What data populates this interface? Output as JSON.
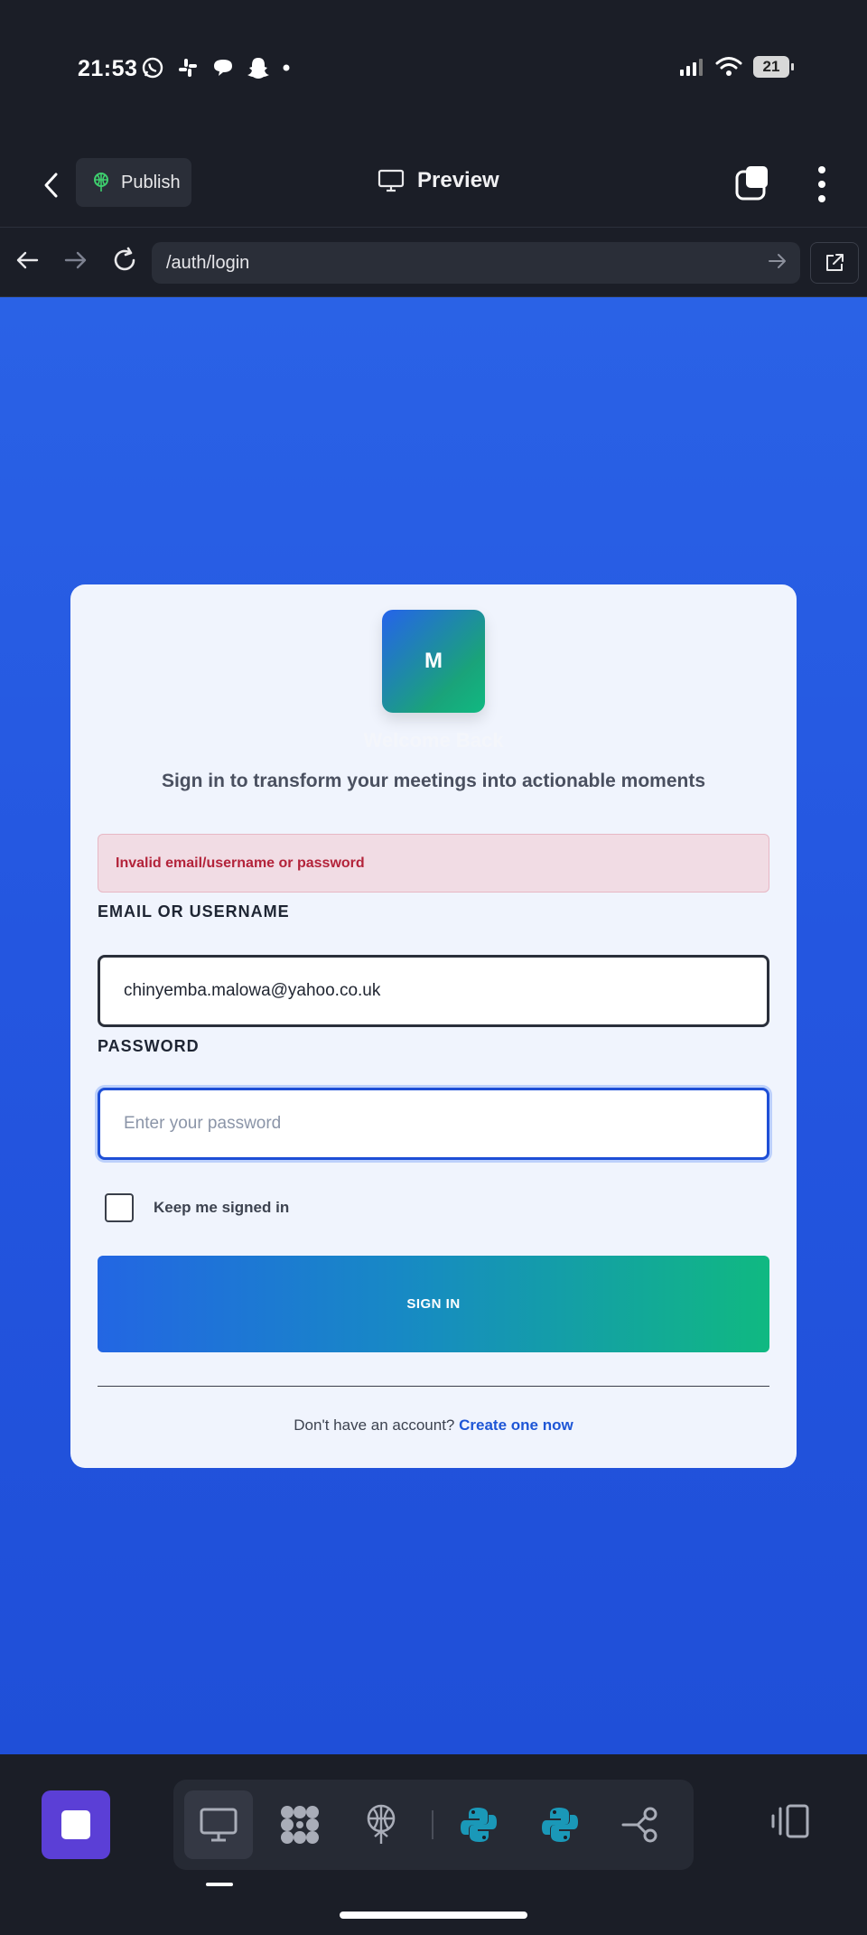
{
  "status_bar": {
    "time": "21:53",
    "battery": "21",
    "notification_icons": [
      "whatsapp-icon",
      "slack-icon",
      "chat-bubble-icon",
      "snapchat-icon",
      "dot-icon"
    ]
  },
  "app_header": {
    "publish_label": "Publish",
    "preview_label": "Preview"
  },
  "url_bar": {
    "url": "/auth/login"
  },
  "login_card": {
    "logo_letter": "M",
    "welcome": "Welcome Back",
    "subtitle": "Sign in to transform your meetings into actionable moments",
    "error": "Invalid email/username or password",
    "email_label": "EMAIL OR USERNAME",
    "email_value": "chinyemba.malowa@yahoo.co.uk",
    "password_label": "PASSWORD",
    "password_placeholder": "Enter your password",
    "remember_label": "Keep me signed in",
    "remember_checked": false,
    "signin_label": "SIGN IN",
    "signup_prompt": "Don't have an account?",
    "signup_link": "Create one now"
  },
  "colors": {
    "accent_blue": "#2366e3",
    "accent_green": "#10b981",
    "error_red": "#b3233a",
    "background_blue": "#2456e0",
    "dark_chrome": "#1b1e27"
  },
  "dock": {
    "tools": [
      "desktop-icon",
      "apps-grid-icon",
      "publish-tree-icon",
      "python-icon",
      "python-icon",
      "share-graph-icon"
    ],
    "active_tool": "desktop-icon"
  }
}
